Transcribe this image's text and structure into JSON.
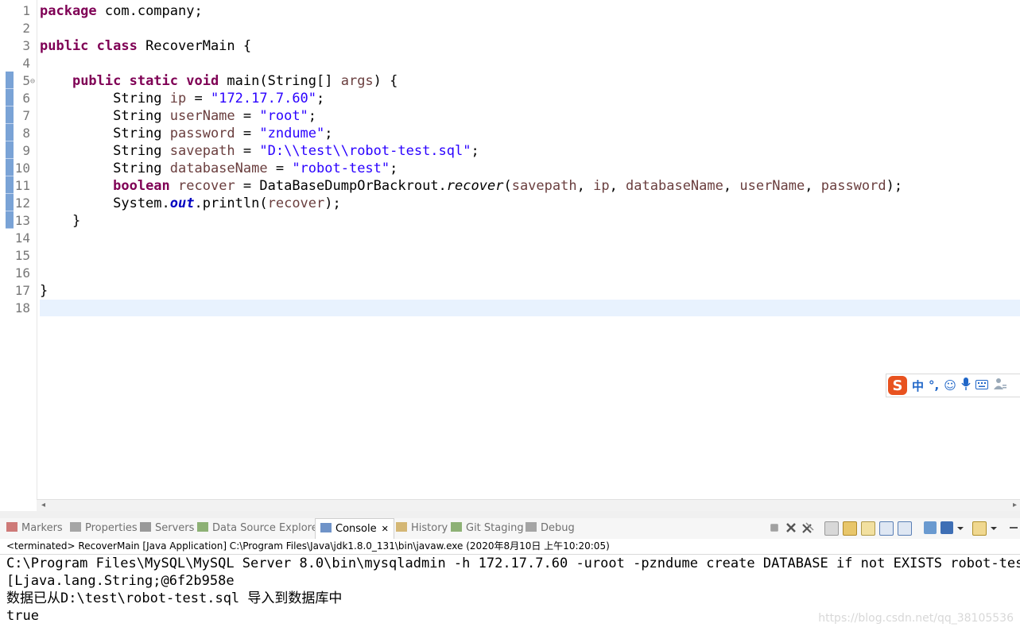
{
  "editor": {
    "lines": [
      {
        "num": "1",
        "fold": "",
        "html": "<span class='kw'>package</span> com.company;"
      },
      {
        "num": "2",
        "fold": "",
        "html": ""
      },
      {
        "num": "3",
        "fold": "",
        "html": "<span class='kw'>public class</span> RecoverMain {"
      },
      {
        "num": "4",
        "fold": "",
        "html": ""
      },
      {
        "num": "5",
        "fold": "⊖",
        "html": "    <span class='kw'>public static void</span> main(String[] <span class='var'>args</span>) {"
      },
      {
        "num": "6",
        "fold": "",
        "html": "         String <span class='var'>ip</span> = <span class='str'>\"172.17.7.60\"</span>;"
      },
      {
        "num": "7",
        "fold": "",
        "html": "         String <span class='var'>userName</span> = <span class='str'>\"root\"</span>;"
      },
      {
        "num": "8",
        "fold": "",
        "html": "         String <span class='var'>password</span> = <span class='str'>\"zndume\"</span>;"
      },
      {
        "num": "9",
        "fold": "",
        "html": "         String <span class='var'>savepath</span> = <span class='str'>\"D:\\\\test\\\\robot-test.sql\"</span>;"
      },
      {
        "num": "10",
        "fold": "",
        "html": "         String <span class='var'>databaseName</span> = <span class='str'>\"robot-test\"</span>;"
      },
      {
        "num": "11",
        "fold": "",
        "html": "         <span class='kw'>boolean</span> <span class='var'>recover</span> = DataBaseDumpOrBackrout.<span class='it'>recover</span>(<span class='var'>savepath</span>, <span class='var'>ip</span>, <span class='var'>databaseName</span>, <span class='var'>userName</span>, <span class='var'>password</span>);"
      },
      {
        "num": "12",
        "fold": "",
        "html": "         System.<span class='sf'>out</span>.println(<span class='var'>recover</span>);"
      },
      {
        "num": "13",
        "fold": "",
        "html": "    }"
      },
      {
        "num": "14",
        "fold": "",
        "html": ""
      },
      {
        "num": "15",
        "fold": "",
        "html": ""
      },
      {
        "num": "16",
        "fold": "",
        "html": ""
      },
      {
        "num": "17",
        "fold": "",
        "html": "}"
      },
      {
        "num": "18",
        "fold": "",
        "html": ""
      }
    ]
  },
  "ime": {
    "logo": "S",
    "mode": "中",
    "punct": "°,",
    "emoji": "☺",
    "mic": "🎙",
    "keyboard": "⌨",
    "more": "⛭"
  },
  "tabs": [
    {
      "label": "Markers",
      "icon": "markers-icon",
      "color": "#c0504d"
    },
    {
      "label": "Properties",
      "icon": "properties-icon",
      "color": "#8a8a8a"
    },
    {
      "label": "Servers",
      "icon": "servers-icon",
      "color": "#7a7a7a"
    },
    {
      "label": "Data Source Explorer",
      "icon": "data-source-icon",
      "color": "#6a9a4a"
    },
    {
      "label": "Console",
      "icon": "console-icon",
      "color": "#3f6fb5",
      "close": "✕"
    },
    {
      "label": "History",
      "icon": "history-icon",
      "color": "#c8a24a"
    },
    {
      "label": "Git Staging",
      "icon": "git-staging-icon",
      "color": "#6a9a4a"
    },
    {
      "label": "Debug",
      "icon": "debug-icon",
      "color": "#8a8a8a"
    }
  ],
  "console": {
    "status": "<terminated> RecoverMain [Java Application] C:\\Program Files\\Java\\jdk1.8.0_131\\bin\\javaw.exe (2020年8月10日 上午10:20:05)",
    "output": [
      "C:\\Program Files\\MySQL\\MySQL Server 8.0\\bin\\mysqladmin -h 172.17.7.60 -uroot -pzndume create DATABASE if not EXISTS robot-test",
      "[Ljava.lang.String;@6f2b958e",
      "数据已从D:\\test\\robot-test.sql 导入到数据库中",
      "true"
    ]
  },
  "watermark": "https://blog.csdn.net/qq_38105536"
}
